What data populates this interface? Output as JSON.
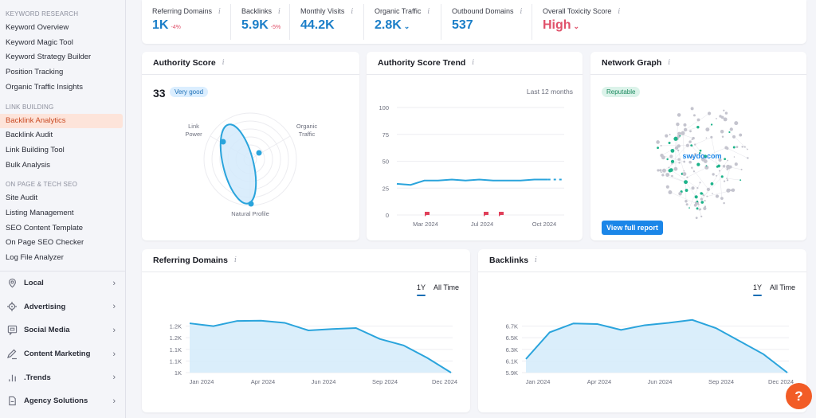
{
  "sidebar": {
    "sections": [
      {
        "title": "KEYWORD RESEARCH",
        "items": [
          "Keyword Overview",
          "Keyword Magic Tool",
          "Keyword Strategy Builder",
          "Position Tracking",
          "Organic Traffic Insights"
        ]
      },
      {
        "title": "LINK BUILDING",
        "items": [
          "Backlink Analytics",
          "Backlink Audit",
          "Link Building Tool",
          "Bulk Analysis"
        ]
      },
      {
        "title": "ON PAGE & TECH SEO",
        "items": [
          "Site Audit",
          "Listing Management",
          "SEO Content Template",
          "On Page SEO Checker",
          "Log File Analyzer"
        ]
      }
    ],
    "active_item": "Backlink Analytics",
    "categories": [
      {
        "label": "Local",
        "icon": "location-pin-icon"
      },
      {
        "label": "Advertising",
        "icon": "target-icon"
      },
      {
        "label": "Social Media",
        "icon": "chat-screen-icon"
      },
      {
        "label": "Content Marketing",
        "icon": "pencil-icon"
      },
      {
        "label": ".Trends",
        "icon": "bar-chart-icon"
      },
      {
        "label": "Agency Solutions",
        "icon": "document-icon"
      }
    ]
  },
  "metrics": [
    {
      "label": "Referring Domains",
      "value": "1K",
      "delta": "-4%"
    },
    {
      "label": "Backlinks",
      "value": "5.9K",
      "delta": "-5%"
    },
    {
      "label": "Monthly Visits",
      "value": "44.2K"
    },
    {
      "label": "Organic Traffic",
      "value": "2.8K",
      "caret": "⌄"
    },
    {
      "label": "Outbound Domains",
      "value": "537"
    },
    {
      "label": "Overall Toxicity Score",
      "value": "High",
      "caret": "⌄",
      "status": "high"
    }
  ],
  "authority_score": {
    "title": "Authority Score",
    "score": "33",
    "badge": "Very good",
    "axes": {
      "link_power": "Link\nPower",
      "organic_traffic": "Organic\nTraffic",
      "natural_profile": "Natural Profile"
    }
  },
  "authority_trend": {
    "title": "Authority Score Trend",
    "range_label": "Last 12 months"
  },
  "network_graph": {
    "title": "Network Graph",
    "badge": "Reputable",
    "center_label": "swydo.com",
    "button": "View full report"
  },
  "referring_domains": {
    "title": "Referring Domains",
    "tabs": [
      "1Y",
      "All Time"
    ],
    "active_tab": "1Y"
  },
  "backlinks": {
    "title": "Backlinks",
    "tabs": [
      "1Y",
      "All Time"
    ],
    "active_tab": "1Y"
  },
  "help_button": "?",
  "chart_data": [
    {
      "id": "authority_trend",
      "type": "line",
      "title": "Authority Score Trend",
      "ylim": [
        0,
        100
      ],
      "yticks": [
        0,
        25,
        50,
        75,
        100
      ],
      "xticks": [
        "Mar 2024",
        "Jul 2024",
        "Oct 2024"
      ],
      "series": [
        {
          "name": "Authority Score",
          "values": [
            29,
            28,
            32,
            32,
            33,
            32,
            33,
            32,
            32,
            32,
            33,
            33,
            33
          ],
          "projected_from_index": 11
        }
      ],
      "markers": [
        "Mar 2024",
        "Jul 2024",
        "Aug 2024"
      ],
      "grid": true
    },
    {
      "id": "referring_domains",
      "type": "area",
      "title": "Referring Domains",
      "ylim": [
        1000,
        1225
      ],
      "yticks": [
        "1K",
        "1.1K",
        "1.1K",
        "1.2K",
        "1.2K"
      ],
      "xticks": [
        "Jan 2024",
        "Apr 2024",
        "Jun 2024",
        "Sep 2024",
        "Dec 2024"
      ],
      "series": [
        {
          "name": "Referring Domains",
          "values": [
            1208,
            1196,
            1218,
            1219,
            1210,
            1178,
            1184,
            1188,
            1142,
            1115,
            1062,
            1000
          ]
        }
      ],
      "grid": true
    },
    {
      "id": "backlinks",
      "type": "area",
      "title": "Backlinks",
      "ylim": [
        5900,
        6800
      ],
      "yticks": [
        "5.9K",
        "6.1K",
        "6.3K",
        "6.5K",
        "6.7K"
      ],
      "xticks": [
        "Jan 2024",
        "Apr 2024",
        "Jun 2024",
        "Sep 2024",
        "Dec 2024"
      ],
      "series": [
        {
          "name": "Backlinks",
          "values": [
            6130,
            6580,
            6730,
            6720,
            6620,
            6700,
            6740,
            6790,
            6650,
            6430,
            6210,
            5900
          ]
        }
      ],
      "grid": true
    }
  ]
}
